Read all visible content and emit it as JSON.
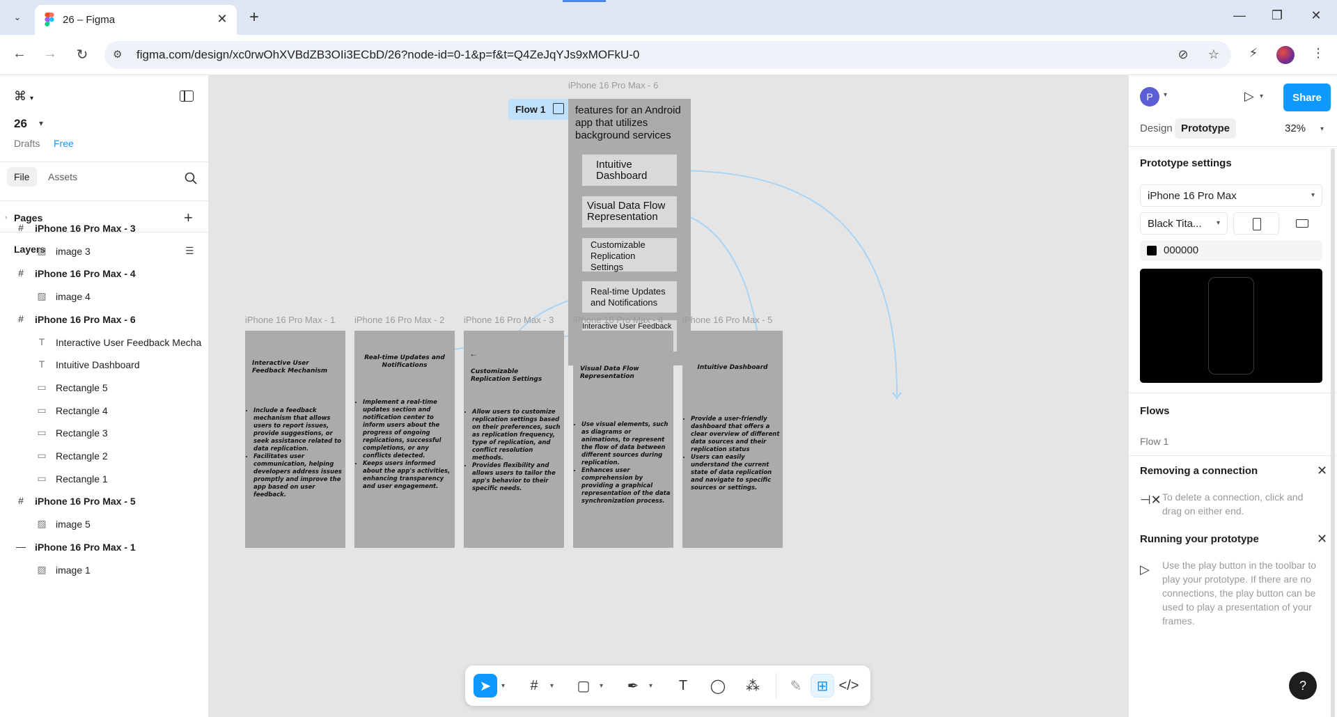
{
  "browser": {
    "tab_title": "26 – Figma",
    "url": "figma.com/design/xc0rwOhXVBdZB3OIi3ECbD/26?node-id=0-1&p=f&t=Q4ZeJqYJs9xMOFkU-0"
  },
  "left_panel": {
    "file_name": "26",
    "drafts_label": "Drafts",
    "plan_label": "Free",
    "tabs": {
      "file": "File",
      "assets": "Assets"
    },
    "pages_label": "Pages",
    "layers_label": "Layers",
    "layers": [
      {
        "label": "iPhone 16 Pro Max - 3",
        "kind": "frame",
        "icon": "frame-icon"
      },
      {
        "label": "image 3",
        "kind": "child",
        "icon": "image-icon"
      },
      {
        "label": "iPhone 16 Pro Max - 4",
        "kind": "frame",
        "icon": "frame-icon"
      },
      {
        "label": "image 4",
        "kind": "child",
        "icon": "image-icon"
      },
      {
        "label": "iPhone 16 Pro Max - 6",
        "kind": "frame",
        "icon": "frame-icon"
      },
      {
        "label": "Interactive User Feedback Mecha",
        "kind": "child",
        "icon": "text-icon"
      },
      {
        "label": "Intuitive Dashboard",
        "kind": "child",
        "icon": "text-icon"
      },
      {
        "label": "Rectangle 5",
        "kind": "child",
        "icon": "rectangle-icon"
      },
      {
        "label": "Rectangle 4",
        "kind": "child",
        "icon": "rectangle-icon"
      },
      {
        "label": "Rectangle 3",
        "kind": "child",
        "icon": "rectangle-icon"
      },
      {
        "label": "Rectangle 2",
        "kind": "child",
        "icon": "rectangle-icon"
      },
      {
        "label": "Rectangle 1",
        "kind": "child",
        "icon": "rectangle-icon"
      },
      {
        "label": "iPhone 16 Pro Max - 5",
        "kind": "frame",
        "icon": "frame-icon"
      },
      {
        "label": "image 5",
        "kind": "child",
        "icon": "image-icon"
      },
      {
        "label": "iPhone 16 Pro Max - 1",
        "kind": "frame",
        "icon": "frame-collapsed-icon"
      },
      {
        "label": "image 1",
        "kind": "child",
        "icon": "image-icon"
      }
    ]
  },
  "canvas": {
    "main_frame_label": "iPhone 16 Pro Max - 6",
    "flow_badge": "Flow 1",
    "main_frame_heading": "features for an Android app that utilizes background services",
    "main_buttons": [
      "Intuitive Dashboard",
      "Visual Data Flow Representation",
      "Customizable Replication Settings",
      "Real-time Updates and Notifications",
      "Interactive User Feedback Mechanism"
    ],
    "screens": [
      {
        "label": "iPhone 16 Pro Max - 1",
        "title": "Interactive User Feedback Mechanism",
        "bullets": [
          "Include a feedback mechanism that allows users to report issues, provide suggestions, or seek assistance related to data replication.",
          "Facilitates user communication, helping developers address issues promptly and improve the app based on user feedback."
        ]
      },
      {
        "label": "iPhone 16 Pro Max - 2",
        "title": "Real-time Updates and Notifications",
        "bullets": [
          "Implement a real-time updates section and notification center to inform users about the progress of ongoing replications, successful completions, or any conflicts detected.",
          "Keeps users informed about the app's activities, enhancing transparency and user engagement."
        ]
      },
      {
        "label": "iPhone 16 Pro Max - 3",
        "title": "Customizable Replication Settings",
        "back": "←",
        "bullets": [
          "Allow users to customize replication settings based on their preferences, such as replication frequency, type of replication, and conflict resolution methods.",
          "Provides flexibility and allows users to tailor the app's behavior to their specific needs."
        ]
      },
      {
        "label": "iPhone 16 Pro Max - 4",
        "title": "Visual Data Flow Representation",
        "bullets": [
          "Use visual elements, such as diagrams or animations, to represent the flow of data between different sources during replication.",
          "Enhances user comprehension by providing a graphical representation of the data synchronization process."
        ]
      },
      {
        "label": "iPhone 16 Pro Max - 5",
        "title": "Intuitive Dashboard",
        "bullets": [
          "Provide a user-friendly dashboard that offers a clear overview of different data sources and their replication status",
          "Users can easily understand the current state of data replication and navigate to specific sources or settings."
        ]
      }
    ]
  },
  "right_panel": {
    "avatar_letter": "P",
    "share_label": "Share",
    "tabs": {
      "design": "Design",
      "prototype": "Prototype"
    },
    "zoom": "32%",
    "prototype_settings_title": "Prototype settings",
    "device": "iPhone 16 Pro Max",
    "device_color": "Black Tita...",
    "background_hex": "000000",
    "flows_title": "Flows",
    "flow_item": "Flow 1",
    "removing_title": "Removing a connection",
    "removing_text": "To delete a connection, click and drag on either end.",
    "running_title": "Running your prototype",
    "running_text": "Use the play button in the toolbar to play your prototype. If there are no connections, the play button can be used to play a presentation of your frames.",
    "help": "?"
  },
  "colors": {
    "accent": "#0d99ff",
    "frame_fill": "#ababab",
    "button_fill": "#d9d9d9",
    "connector": "#a8d4f5"
  }
}
